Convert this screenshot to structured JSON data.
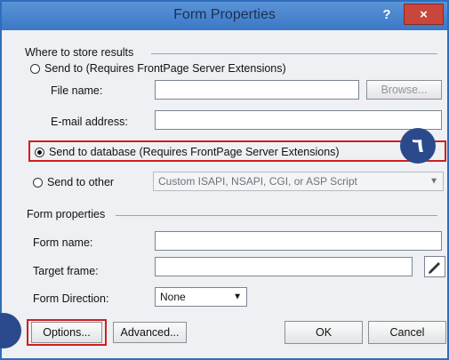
{
  "title": "Form Properties",
  "help": "?",
  "close": "×",
  "store_section": "Where to store results",
  "send_to": {
    "label": "Send to (Requires FrontPage Server Extensions)",
    "file_name_label": "File name:",
    "email_label": "E-mail address:",
    "browse": "Browse..."
  },
  "send_db": "Send to database (Requires FrontPage Server Extensions)",
  "send_other": {
    "label": "Send to other",
    "value": "Custom ISAPI, NSAPI, CGI, or ASP Script"
  },
  "form_section": "Form properties",
  "form_name_label": "Form name:",
  "target_frame_label": "Target frame:",
  "direction_label": "Form Direction:",
  "direction_value": "None",
  "buttons": {
    "options": "Options...",
    "advanced": "Advanced...",
    "ok": "OK",
    "cancel": "Cancel"
  },
  "callout_number": "٦",
  "colors": {
    "highlight": "#d11d1d",
    "callout": "#2a4a8c",
    "title_bar": "#3b78c6"
  }
}
